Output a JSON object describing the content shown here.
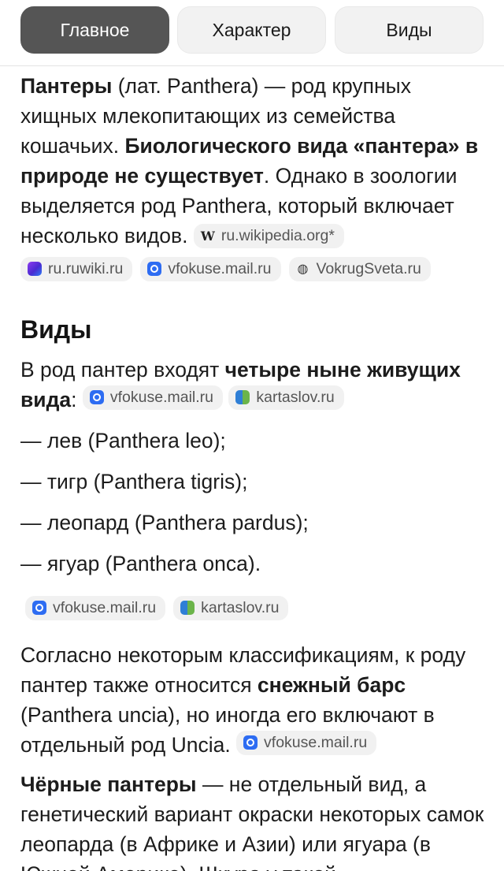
{
  "tabs": [
    "Главное",
    "Характер",
    "Виды"
  ],
  "intro": {
    "bold1": "Пантеры",
    "t1": " (лат. Panthera) — род крупных хищных млекопитающих из семейства кошачьих. ",
    "bold2": "Биологического вида «пантера» в природе не существует",
    "t2": ". Однако в зоологии выделяется род Panthera, который включает несколько видов. ",
    "src_wiki": "ru.wikipedia.org*",
    "sources": [
      "ru.ruwiki.ru",
      "vfokuse.mail.ru",
      "VokrugSveta.ru"
    ]
  },
  "species": {
    "heading": "Виды",
    "t1": "В род пантер входят ",
    "bold": "четыре ныне живущих вида",
    "t2": ": ",
    "sources": [
      "vfokuse.mail.ru",
      "kartaslov.ru"
    ],
    "list": [
      "— лев (Panthera leo);",
      "— тигр (Panthera tigris);",
      "— леопард (Panthera pardus);",
      "— ягуар (Panthera onca)."
    ],
    "list_sources": [
      "vfokuse.mail.ru",
      "kartaslov.ru"
    ]
  },
  "snow": {
    "t1": "Согласно некоторым классификациям, к роду пантер также относится ",
    "bold": "снежный барс",
    "t2": " (Panthera uncia), но иногда его включают в отдельный род Uncia. ",
    "source": "vfokuse.mail.ru"
  },
  "black": {
    "bold": "Чёрные пантеры",
    "t1": " — не отдельный вид, а генетический вариант окраски некоторых самок леопарда (в Африке и Азии) или ягуара (в Южной Америке). Шкура у такой"
  }
}
